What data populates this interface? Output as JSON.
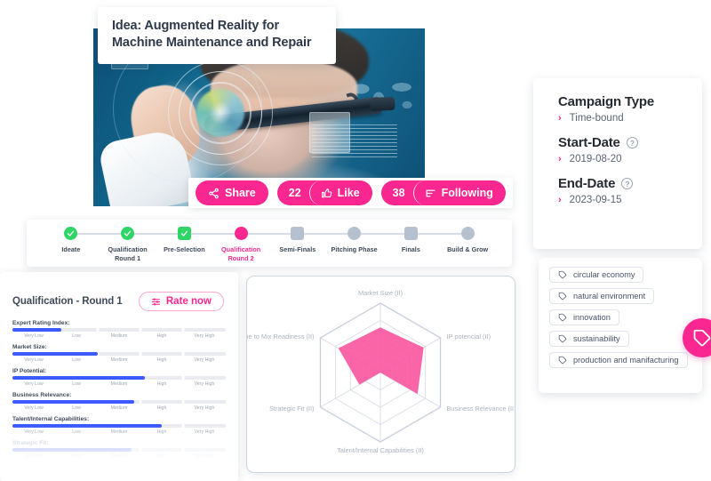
{
  "idea": {
    "title": "Idea: Augmented Reality for Machine Maintenance and Repair",
    "hero_alt": "man-wearing-augmented-reality-glasses"
  },
  "actions": {
    "share_label": "Share",
    "like_label": "Like",
    "like_count": "22",
    "following_label": "Following",
    "following_count": "38",
    "share_icon": "share-icon",
    "like_icon": "thumbs-up-icon",
    "following_icon": "list-icon"
  },
  "stepper": {
    "steps": [
      {
        "label": "Ideate",
        "state": "done",
        "shape": "circle"
      },
      {
        "label": "Qualification Round 1",
        "state": "done",
        "shape": "circle"
      },
      {
        "label": "Pre-Selection",
        "state": "done",
        "shape": "square"
      },
      {
        "label": "Qualification Round 2",
        "state": "active",
        "shape": "circle"
      },
      {
        "label": "Semi-Finals",
        "state": "todo",
        "shape": "square"
      },
      {
        "label": "Pitching Phase",
        "state": "todo",
        "shape": "circle"
      },
      {
        "label": "Finals",
        "state": "todo",
        "shape": "square"
      },
      {
        "label": "Build & Grow",
        "state": "todo",
        "shape": "circle"
      }
    ]
  },
  "rating": {
    "title": "Qualification - Round 1",
    "rate_button": "Rate now",
    "rate_icon": "sliders-icon",
    "scale": [
      "Very Low",
      "Low",
      "Medium",
      "High",
      "Very High"
    ],
    "criteria": [
      {
        "name": "Expert Rating Index:",
        "value": 23,
        "faded": false
      },
      {
        "name": "Market Size:",
        "value": 40,
        "faded": false
      },
      {
        "name": "IP Potential:",
        "value": 62,
        "faded": false
      },
      {
        "name": "Business Relevance:",
        "value": 57,
        "faded": false
      },
      {
        "name": "Talent/Internal Capabilities:",
        "value": 70,
        "faded": false
      },
      {
        "name": "Strategic Fit:",
        "value": 56,
        "faded": true
      }
    ]
  },
  "chart_data": {
    "type": "radar",
    "title": "",
    "categories": [
      "Market Size (II)",
      "IP potencial (II)",
      "Business Relevance (II)",
      "Talent/Internal Capabilities (II)",
      "Strategic Fit (II)",
      "Time to Mix Readiness (II)"
    ],
    "values": [
      0.65,
      0.72,
      0.62,
      0.0,
      0.35,
      0.7
    ],
    "rmax": 1.0,
    "rings": 4,
    "grid": true,
    "legend": "none",
    "fill_color": "#f9509c",
    "grid_color": "#c8cfdb",
    "label_color": "#aab3bf"
  },
  "campaign": {
    "type_label": "Campaign Type",
    "type_value": "Time-bound",
    "start_label": "Start-Date",
    "start_value": "2019-08-20",
    "end_label": "End-Date",
    "end_value": "2023-09-15",
    "help_glyph": "?"
  },
  "tags": {
    "items": [
      "circular economy",
      "natural environment",
      "innovation",
      "sustainability",
      "production and manifacturing"
    ],
    "badge_icon": "tag-icon"
  },
  "colors": {
    "accent_pink": "#f9278f",
    "done_green": "#2fd566",
    "todo_gray": "#b6c1cf",
    "bar_blue": "#3d5afe"
  }
}
